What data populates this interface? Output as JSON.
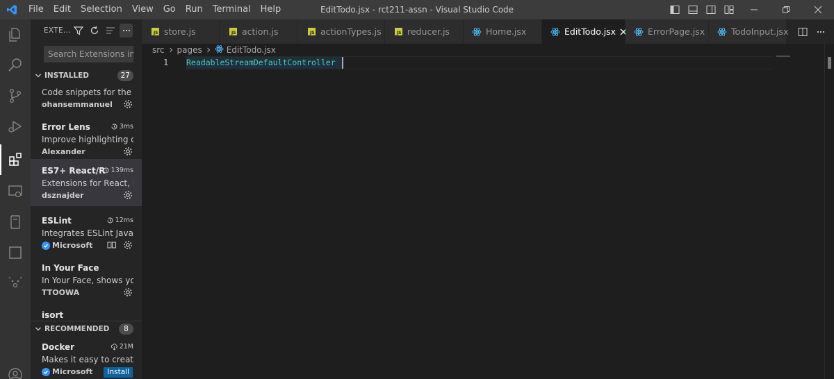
{
  "titlebar": {
    "menu": [
      "File",
      "Edit",
      "Selection",
      "View",
      "Go",
      "Run",
      "Terminal",
      "Help"
    ],
    "title": "EditTodo.jsx - rct211-assn - Visual Studio Code"
  },
  "sidebar": {
    "title": "EXTE...",
    "search_placeholder": "Search Extensions in...",
    "installed": {
      "label": "INSTALLED",
      "count": "27",
      "items": [
        {
          "name": "",
          "meta": "",
          "description": "Code snippets for the ...",
          "publisher": "ohansemmanuel"
        },
        {
          "name": "Error Lens",
          "meta": "3ms",
          "description": "Improve highlighting o...",
          "publisher": "Alexander"
        },
        {
          "name": "ES7+ React/R...",
          "meta": "139ms",
          "description": "Extensions for React, R...",
          "publisher": "dsznajder"
        },
        {
          "name": "ESLint",
          "meta": "12ms",
          "description": "Integrates ESLint JavaS...",
          "publisher": "Microsoft"
        },
        {
          "name": "In Your Face",
          "meta": "",
          "description": "In Your Face, shows yo...",
          "publisher": "TTOOWA"
        },
        {
          "name": "isort",
          "meta": "",
          "description": "",
          "publisher": ""
        }
      ]
    },
    "recommended": {
      "label": "RECOMMENDED",
      "count": "8",
      "items": [
        {
          "name": "Docker",
          "meta": "21M",
          "description": "Makes it easy to create...",
          "publisher": "Microsoft",
          "action": "Install"
        }
      ]
    }
  },
  "tabs": [
    {
      "label": "store.js",
      "icon": "js-icon"
    },
    {
      "label": "action.js",
      "icon": "js-icon"
    },
    {
      "label": "actionTypes.js",
      "icon": "js-icon"
    },
    {
      "label": "reducer.js",
      "icon": "js-icon"
    },
    {
      "label": "Home.jsx",
      "icon": "react-icon"
    },
    {
      "label": "EditTodo.jsx",
      "icon": "react-icon",
      "active": true
    },
    {
      "label": "ErrorPage.jsx",
      "icon": "react-icon"
    },
    {
      "label": "TodoInput.jsx",
      "icon": "react-icon"
    }
  ],
  "breadcrumb": {
    "parts": [
      "src",
      "pages",
      "EditTodo.jsx"
    ]
  },
  "editor": {
    "line_number": "1",
    "code": "ReadableStreamDefaultController"
  },
  "colors": {
    "accent": "#007acc",
    "react": "#4fc1ff",
    "js": "#cbcb41",
    "code_token": "#4ec9b0"
  }
}
